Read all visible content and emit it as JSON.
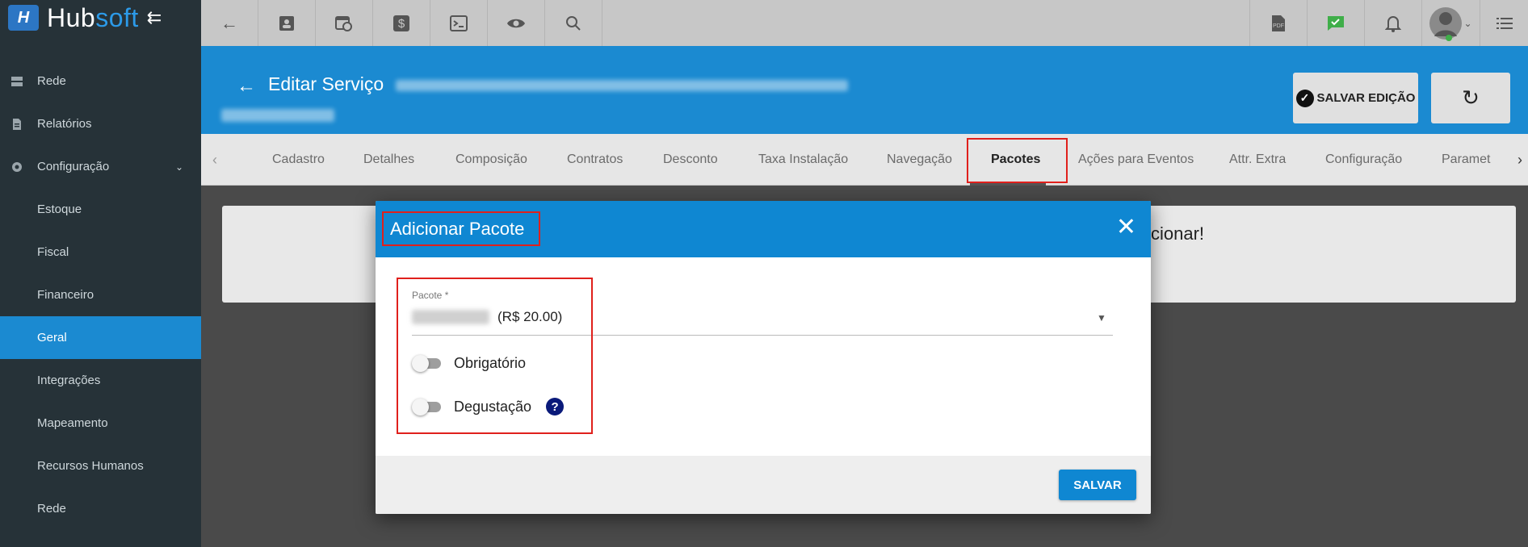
{
  "app": {
    "logo_hub": "Hub",
    "logo_soft": "soft"
  },
  "sidebar": {
    "items": [
      {
        "label": "Rede",
        "icon": "server-icon"
      },
      {
        "label": "Relatórios",
        "icon": "document-icon"
      },
      {
        "label": "Configuração",
        "icon": "gear-icon"
      },
      {
        "label": "Estoque"
      },
      {
        "label": "Fiscal"
      },
      {
        "label": "Financeiro"
      },
      {
        "label": "Geral",
        "active": true
      },
      {
        "label": "Integrações"
      },
      {
        "label": "Mapeamento"
      },
      {
        "label": "Recursos Humanos"
      },
      {
        "label": "Rede"
      }
    ]
  },
  "header": {
    "title": "Editar Serviço",
    "save_edit_label": "SALVAR EDIÇÃO"
  },
  "tabs": [
    "Cadastro",
    "Detalhes",
    "Composição",
    "Contratos",
    "Desconto",
    "Taxa Instalação",
    "Navegação",
    "Pacotes",
    "Ações para Eventos",
    "Attr. Extra",
    "Configuração",
    "Paramet"
  ],
  "active_tab": "Pacotes",
  "card": {
    "partial_text": "cionar!"
  },
  "modal": {
    "title": "Adicionar Pacote",
    "field_label": "Pacote *",
    "field_value_price": "(R$ 20.00)",
    "toggle_required": "Obrigatório",
    "toggle_trial": "Degustação",
    "help": "?",
    "save_label": "SALVAR"
  },
  "colors": {
    "accent": "#1b8ad1",
    "sidebar_bg": "#263238",
    "highlight": "#e0201c"
  }
}
